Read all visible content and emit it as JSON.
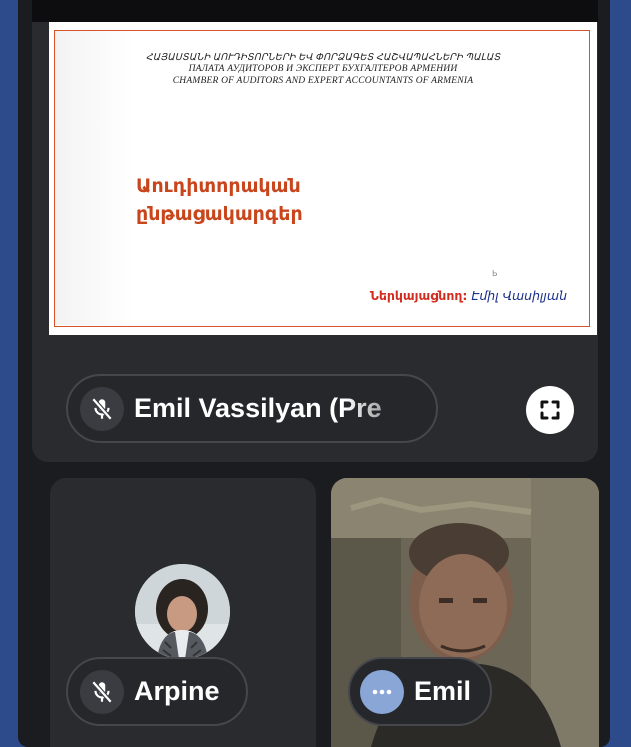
{
  "slide": {
    "header_lines": [
      "ՀԱՅԱՍՏԱՆԻ ԱՈՒԴԻՏՈՐՆԵՐԻ ԵՎ ՓՈՐՁԱԳԵՏ ՀԱՇՎԱՊԱՀՆԵՐԻ ՊԱԼԱՏ",
      "ПАЛАТА АУДИТОРОВ И ЭКСПЕРТ БУХГАЛТЕРОВ АРМЕНИИ",
      "CHAMBER OF AUDITORS AND EXPERT ACCOUNTANTS OF ARMENIA"
    ],
    "title_line1": "Աուդիտորական",
    "title_line2": "ընթացակարգեր",
    "presenter_label": "Ներկայացնող:",
    "presenter_name": "Էմիլ Վասիլյան",
    "cursor_glyph": "Ь"
  },
  "share": {
    "name_label": "Emil Vassilyan (Pre",
    "mic_state": "muted",
    "fullscreen_icon": "fullscreen-icon"
  },
  "participants": [
    {
      "name": "Arpine",
      "status_icon": "mic-off-icon"
    },
    {
      "name": "Emil",
      "status_icon": "more-options-icon"
    }
  ],
  "colors": {
    "background": "#2d4a8a",
    "panel": "#1b1c1f",
    "slide_accent": "#d9532a",
    "slide_title": "#c9451c",
    "presenter_label": "#d32b1e",
    "presenter_name": "#1a2e8a"
  }
}
